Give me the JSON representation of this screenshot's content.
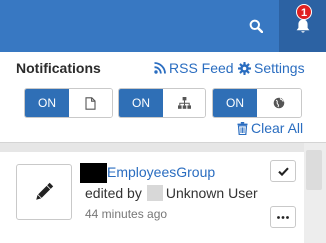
{
  "topbar": {
    "search_icon": "search-icon",
    "bell_icon": "bell-icon",
    "badge_count": "1",
    "background": "#3878c2",
    "active_background": "#2c62a3",
    "badge_color": "#e02020"
  },
  "panel": {
    "title": "Notifications",
    "rss_label": "RSS Feed",
    "settings_label": "Settings",
    "clear_label": "Clear All",
    "link_color": "#2a6dc0",
    "toggles": [
      {
        "label": "ON",
        "icon": "file-icon"
      },
      {
        "label": "ON",
        "icon": "sitemap-icon"
      },
      {
        "label": "ON",
        "icon": "globe-icon"
      }
    ]
  },
  "notification": {
    "group_name": "EmployeesGroup",
    "edited_by_label": "edited by",
    "user_name": "Unknown User",
    "time_ago": "44 minutes ago",
    "thumb_icon": "pencil-icon"
  }
}
